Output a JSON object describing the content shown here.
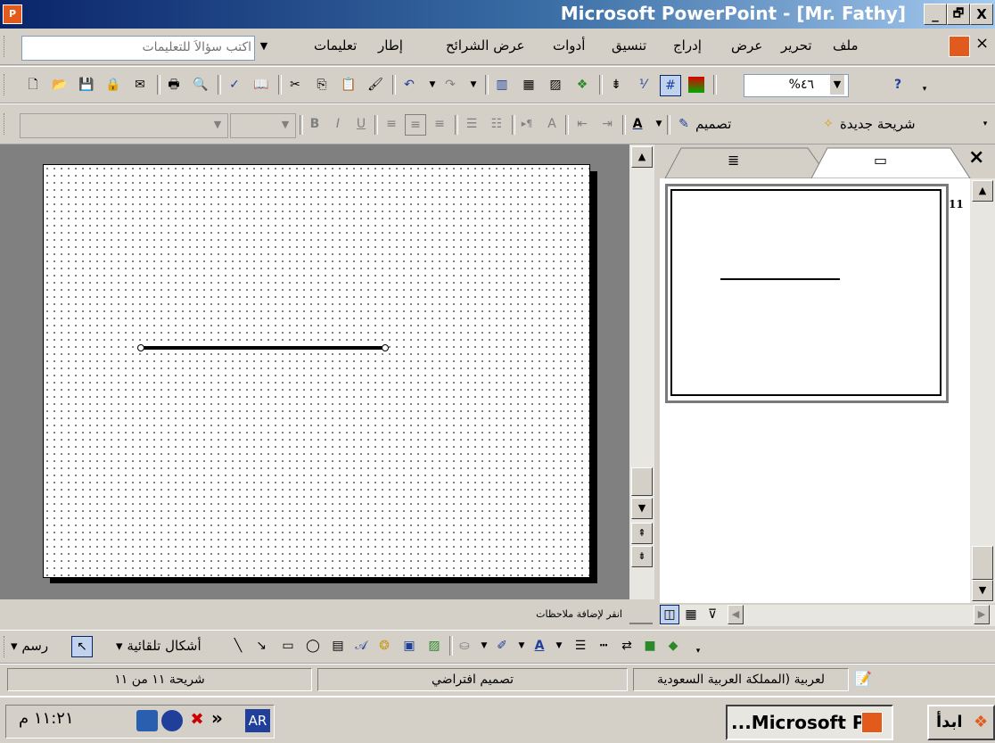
{
  "window": {
    "title": "Microsoft PowerPoint - [Mr. Fathy]",
    "minimize": "_",
    "restore": "🗗",
    "close": "X"
  },
  "menu": {
    "items": [
      "ملف",
      "تحرير",
      "عرض",
      "إدراج",
      "تنسيق",
      "أدوات",
      "عرض الشرائح",
      "إطار",
      "تعليمات"
    ],
    "help_placeholder": "اكتب سؤالاً للتعليمات",
    "doc_close": "×"
  },
  "standard_toolbar": {
    "zoom": "%٤٦"
  },
  "format_toolbar": {
    "font": "",
    "size": "",
    "bold": "B",
    "italic": "I",
    "underline": "U",
    "font_color_label": "A",
    "design_label": "تصميم",
    "new_slide_label": "شريحة جديدة"
  },
  "task_pane": {
    "outline_tab_icon": "outline-icon",
    "slides_tab_icon": "slides-icon",
    "close": "×",
    "thumbnail_number": "11"
  },
  "notes": {
    "placeholder": "انقر لإضافة ملاحظات"
  },
  "drawing_toolbar": {
    "draw_label": "رسم",
    "autoshapes_label": "أشكال تلقائية"
  },
  "status": {
    "slide_info": "شريحة ١١ من ١١",
    "design": "تصميم افتراضي",
    "language": "لعربية (المملكة العربية السعودية"
  },
  "taskbar": {
    "clock": "١١:٢١ م",
    "lang": "AR",
    "app_button": "...Microsoft P",
    "start": "ابدأ",
    "chevron": "»"
  },
  "colors": {
    "title_start": "#0a246a",
    "title_end": "#a6caf0",
    "workspace": "#808080"
  }
}
